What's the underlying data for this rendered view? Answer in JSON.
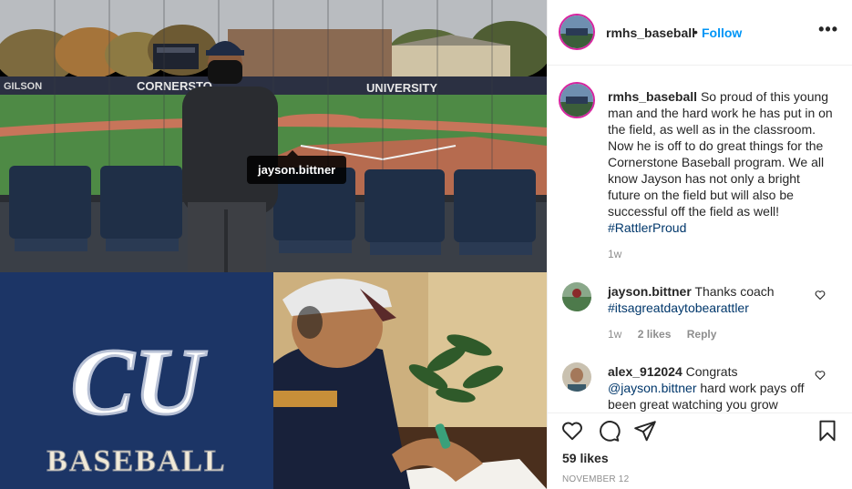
{
  "post": {
    "username": "rmhs_baseball",
    "follow_label": "Follow",
    "more_label": "•••",
    "separator": "•",
    "photo_tag": "jayson.bittner",
    "field_sign_gilson": "GILSON",
    "field_sign_left": "CORNERSTO",
    "field_sign_right": "UNIVERSITY",
    "logo_letters": "CU",
    "logo_word": "BASEBALL"
  },
  "caption": {
    "username": "rmhs_baseball",
    "text": "So proud of this young man and the hard work he has put in on the field, as well as in the classroom. Now he is off to do great things for the Cornerstone Baseball program. We all know Jayson has not only a bright future on the field but will also be successful off the field as well!",
    "hashtag": "#RattlerProud",
    "age": "1w"
  },
  "comments": [
    {
      "username": "jayson.bittner",
      "text": "Thanks coach",
      "link": "#itsagreatdaytobearattler",
      "age": "1w",
      "likes": "2 likes",
      "reply": "Reply"
    },
    {
      "username": "alex_912024",
      "text": "Congrats",
      "link": "@jayson.bittner",
      "text_after": "hard work pays off been great watching you grow"
    }
  ],
  "footer": {
    "likes": "59 likes",
    "date": "NOVEMBER 12"
  },
  "icons": {
    "like": "heart-icon",
    "comment": "comment-icon",
    "share": "paper-plane-icon",
    "save": "bookmark-icon"
  },
  "colors": {
    "follow": "#0095f6",
    "link": "#00376b",
    "muted": "#8e8e8e",
    "logo_bg": "#1c3566"
  }
}
